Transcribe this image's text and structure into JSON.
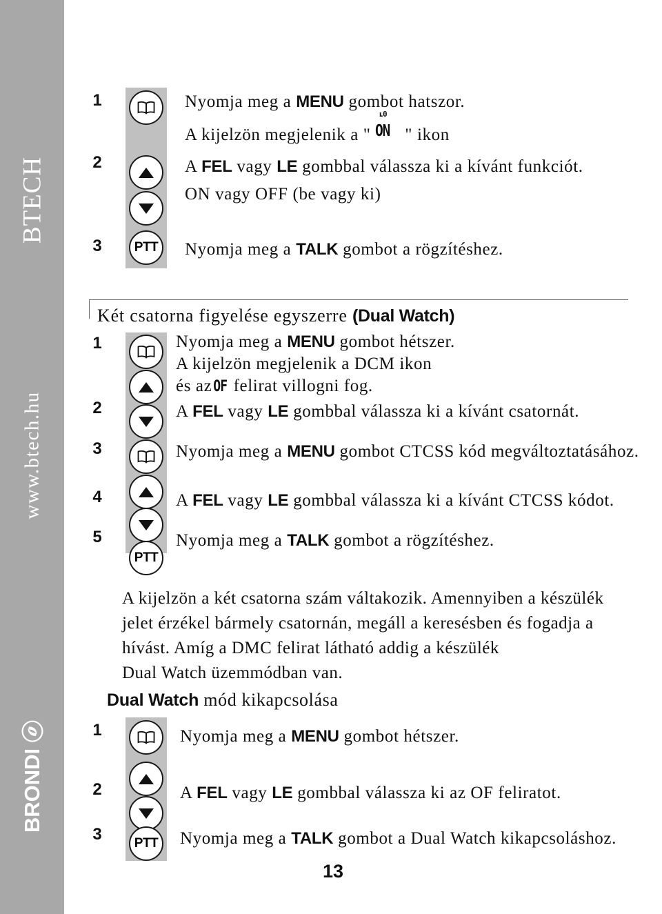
{
  "sidebar": {
    "brand_top": "BTECH",
    "url": "www.btech.hu",
    "brand_bottom": "BRONDI",
    "logo_icon": "brondi-swirl-icon"
  },
  "page": {
    "number": "13"
  },
  "section_top": {
    "steps": [
      {
        "number": "1",
        "icon": "book-menu-icon",
        "lines": [
          {
            "prefix": "Nyomja meg a ",
            "bold": "MENU",
            "suffix": " gombot hatszor."
          },
          {
            "prefix": "A kijelzön megjelenik a \" ",
            "lcd_sup": "ʟ0",
            "lcd_main": "ON",
            "suffix": " \" ikon"
          }
        ]
      },
      {
        "number": "2",
        "icon": "up-arrow-icon",
        "icon2": "down-arrow-icon",
        "lines": [
          {
            "prefix": "A ",
            "bold": "FEL",
            "mid": " vagy ",
            "bold2": "LE",
            "suffix": " gombbal válassza ki a kívánt funkciót."
          },
          {
            "plain": "ON vagy OFF (be vagy ki)"
          }
        ]
      },
      {
        "number": "3",
        "icon": "ptt-button-icon",
        "icon_label": "PTT",
        "lines": [
          {
            "prefix": "Nyomja meg a ",
            "bold": "TALK",
            "suffix": " gombot a rögzítéshez."
          }
        ]
      }
    ]
  },
  "section_dualwatch": {
    "title_plain": "Két csatorna figyelése egyszerre ",
    "title_bold": "(Dual Watch)",
    "steps": [
      {
        "number": "1",
        "icon": "book-menu-icon",
        "lines": [
          {
            "prefix": "Nyomja meg a ",
            "bold": "MENU",
            "suffix": " gombot hétszer."
          },
          {
            "plain": "A kijelzön megjelenik a DCM ikon"
          },
          {
            "prefix": "és az",
            "lcd": "OF",
            "suffix": " felirat villogni fog."
          }
        ]
      },
      {
        "number": "2",
        "icon": "up-arrow-icon",
        "icon2": "down-arrow-icon",
        "lines": [
          {
            "prefix": "A ",
            "bold": "FEL",
            "mid": " vagy ",
            "bold2": "LE",
            "suffix": " gombbal válassza ki a kívánt csatornát."
          }
        ]
      },
      {
        "number": "3",
        "icon": "book-menu-icon",
        "lines": [
          {
            "prefix": "Nyomja meg a ",
            "bold": "MENU",
            "suffix": " gombot CTCSS kód megváltoztatásához."
          }
        ]
      },
      {
        "number": "4",
        "icon": "up-arrow-icon",
        "icon2": "down-arrow-icon",
        "lines": [
          {
            "prefix": "A ",
            "bold": "FEL",
            "mid": " vagy ",
            "bold2": "LE",
            "suffix": " gombbal válassza ki a kívánt CTCSS kódot."
          }
        ]
      },
      {
        "number": "5",
        "icon": "ptt-button-icon",
        "icon_label": "PTT",
        "lines": [
          {
            "prefix": "Nyomja meg a ",
            "bold": "TALK",
            "suffix": " gombot a rögzítéshez."
          }
        ]
      }
    ]
  },
  "note_paragraph": {
    "lines": [
      "A kijelzön a két csatorna szám váltakozik. Amennyiben a készülék",
      "jelet érzékel bármely csatornán, megáll a keresésben és fogadja a",
      "hívást. Amíg a DMC felirat látható addig a készülék",
      "Dual Watch üzemmódban van."
    ]
  },
  "section_turnoff": {
    "title_bold": "Dual Watch",
    "title_plain": " mód kikapcsolása",
    "steps": [
      {
        "number": "1",
        "icon": "book-menu-icon",
        "lines": [
          {
            "prefix": "Nyomja meg a ",
            "bold": "MENU",
            "suffix": " gombot hétszer."
          }
        ]
      },
      {
        "number": "2",
        "icon": "up-arrow-icon",
        "icon2": "down-arrow-icon",
        "lines": [
          {
            "prefix": "A ",
            "bold": "FEL",
            "mid": " vagy ",
            "bold2": "LE",
            "suffix": " gombbal válassza ki az OF feliratot."
          }
        ]
      },
      {
        "number": "3",
        "icon": "ptt-button-icon",
        "icon_label": "PTT",
        "lines": [
          {
            "prefix": "Nyomja meg a ",
            "bold": "TALK",
            "suffix": " gombot a Dual Watch kikapcsoláshoz."
          }
        ]
      }
    ]
  },
  "colors": {
    "sidebar_gray": "#a8a8a8",
    "strip_gray": "#c0c0c0",
    "text_black": "#111111",
    "rule_gray": "#6b6b6b"
  }
}
